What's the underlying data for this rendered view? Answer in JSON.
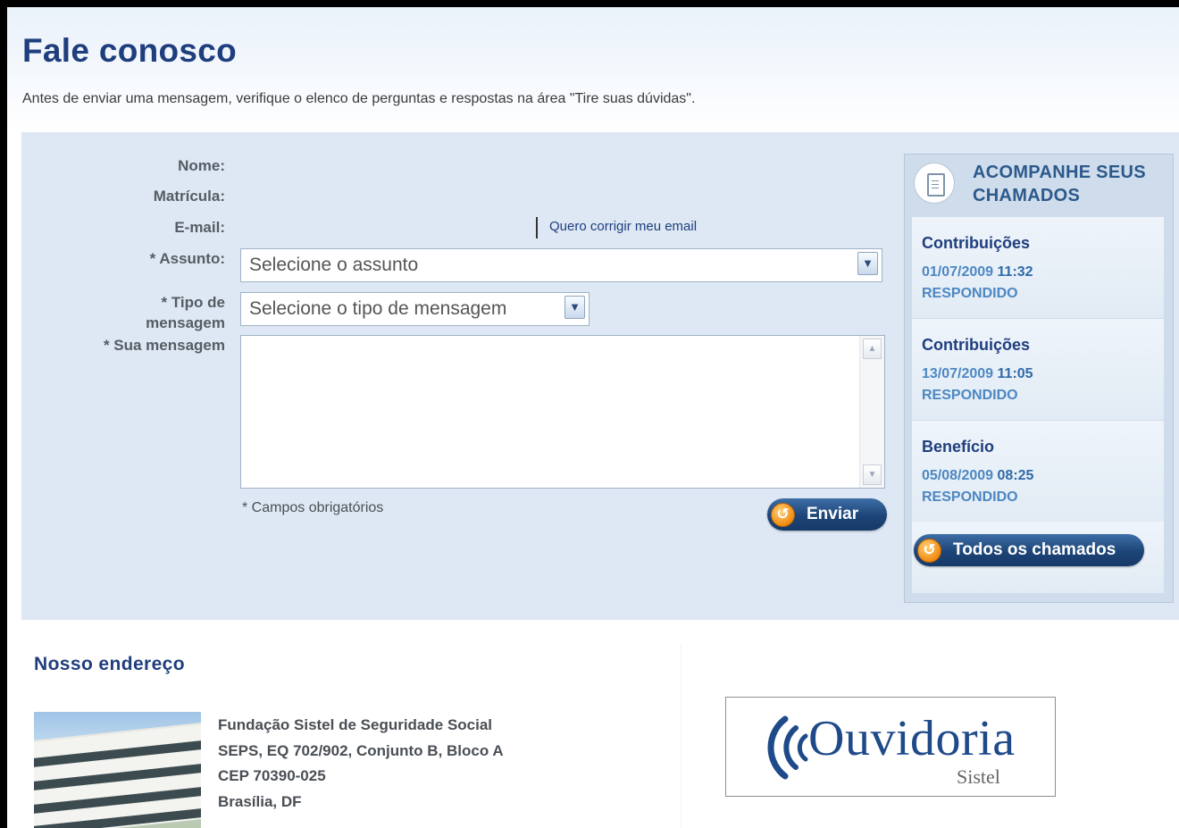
{
  "page": {
    "title": "Fale conosco",
    "intro": "Antes de enviar uma mensagem, verifique o elenco de perguntas e respostas na área \"Tire suas dúvidas\"."
  },
  "form": {
    "labels": {
      "name": "Nome:",
      "registration": "Matrícula:",
      "email": "E-mail:",
      "subject": "* Assunto:",
      "message_type_1": "* Tipo de",
      "message_type_2": "mensagem",
      "message": "* Sua mensagem"
    },
    "correct_email_link": "Quero corrigir meu email",
    "subject_select": {
      "selected": "Selecione o assunto"
    },
    "type_select": {
      "selected": "Selecione o tipo de mensagem"
    },
    "message_value": "",
    "required_note": "* Campos obrigatórios",
    "send_button": "Enviar"
  },
  "tickets_panel": {
    "title_1": "ACOMPANHE SEUS",
    "title_2": "CHAMADOS",
    "items": [
      {
        "category": "Contribuições",
        "date": "01/07/2009",
        "time": "11:32",
        "status": "RESPONDIDO"
      },
      {
        "category": "Contribuições",
        "date": "13/07/2009",
        "time": "11:05",
        "status": "RESPONDIDO"
      },
      {
        "category": "Benefício",
        "date": "05/08/2009",
        "time": "08:25",
        "status": "RESPONDIDO"
      }
    ],
    "all_button": "Todos os chamados"
  },
  "address": {
    "title": "Nosso endereço",
    "lines": [
      "Fundação Sistel de Seguridade Social",
      "SEPS, EQ 702/902, Conjunto B, Bloco A",
      "CEP 70390-025",
      "Brasília, DF"
    ]
  },
  "ouvidoria_logo": {
    "text": "Ouvidoria",
    "subtext": "Sistel"
  },
  "colors": {
    "brand_navy": "#1f3e7e",
    "panel_bg": "#dde8f4",
    "button_orange": "#f08a10",
    "link_blue": "#4d87c2"
  }
}
